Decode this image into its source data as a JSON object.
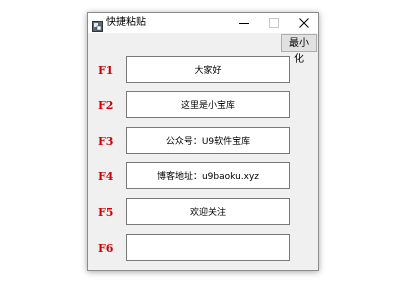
{
  "window": {
    "title": "快捷粘贴",
    "minimize_to_tray_label": "最小化"
  },
  "icons": {
    "app": "app-icon",
    "minimize": "minimize-icon",
    "maximize": "maximize-icon",
    "close": "close-icon"
  },
  "rows": [
    {
      "key": "F1",
      "text": "大家好"
    },
    {
      "key": "F2",
      "text": "这里是小宝库"
    },
    {
      "key": "F3",
      "text": "公众号：U9软件宝库"
    },
    {
      "key": "F4",
      "text": "博客地址：u9baoku.xyz"
    },
    {
      "key": "F5",
      "text": "欢迎关注"
    },
    {
      "key": "F6",
      "text": ""
    }
  ],
  "colors": {
    "key_label": "#d40000",
    "window_bg": "#f0f0f0"
  }
}
